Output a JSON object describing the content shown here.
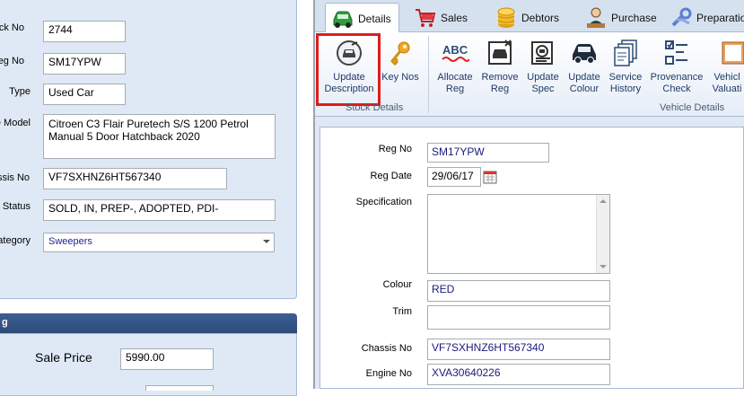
{
  "left_panel": {
    "fields": [
      {
        "label": "tock No",
        "value": "2744"
      },
      {
        "label": "Reg No",
        "value": "SM17YPW"
      },
      {
        "label": "Type",
        "value": "Used Car"
      },
      {
        "label": "e Model",
        "value": "Citroen C3 Flair Puretech S/S 1200 Petrol\nManual  5 Door Hatchback 2020"
      },
      {
        "label": "ssis No",
        "value": "VF7SXHNZ6HT567340"
      },
      {
        "label": "Status",
        "value": "SOLD, IN, PREP-, ADOPTED, PDI-"
      },
      {
        "label": "ategory",
        "value": "Sweepers"
      }
    ],
    "pricing_header": "g",
    "sale_price_label": "Sale Price",
    "sale_price_value": "5990.00"
  },
  "tabs": [
    {
      "label": "Details",
      "icon": "car-icon",
      "active": true
    },
    {
      "label": "Sales",
      "icon": "cart-icon",
      "active": false
    },
    {
      "label": "Debtors",
      "icon": "coins-icon",
      "active": false
    },
    {
      "label": "Purchase",
      "icon": "buyer-icon",
      "active": false
    },
    {
      "label": "Preparation",
      "icon": "wrench-icon",
      "active": false
    }
  ],
  "ribbon": {
    "groups": [
      {
        "label": "Stock Details"
      },
      {
        "label": "Vehicle Details"
      }
    ],
    "buttons": [
      {
        "label": "Update\nDescription",
        "icon": "car-edit-icon"
      },
      {
        "label": "Key Nos",
        "icon": "key-icon"
      },
      {
        "label": "Allocate\nReg",
        "icon": "abc-icon"
      },
      {
        "label": "Remove\nReg",
        "icon": "remove-reg-icon"
      },
      {
        "label": "Update\nSpec",
        "icon": "spec-icon"
      },
      {
        "label": "Update\nColour",
        "icon": "car-colour-icon"
      },
      {
        "label": "Service\nHistory",
        "icon": "documents-icon"
      },
      {
        "label": "Provenance\nCheck",
        "icon": "checklist-icon"
      },
      {
        "label": "Vehicl\nValuati",
        "icon": "valuation-icon"
      }
    ]
  },
  "details_form": {
    "reg_no": {
      "label": "Reg No",
      "value": "SM17YPW"
    },
    "reg_date": {
      "label": "Reg Date",
      "value": "29/06/17"
    },
    "specification": {
      "label": "Specification",
      "value": ""
    },
    "colour": {
      "label": "Colour",
      "value": "RED"
    },
    "trim": {
      "label": "Trim",
      "value": ""
    },
    "chassis_no": {
      "label": "Chassis No",
      "value": "VF7SXHNZ6HT567340"
    },
    "engine_no": {
      "label": "Engine No",
      "value": "XVA30640226"
    }
  },
  "colors": {
    "highlight": "#e01b1b",
    "accent": "#2d4b78"
  }
}
